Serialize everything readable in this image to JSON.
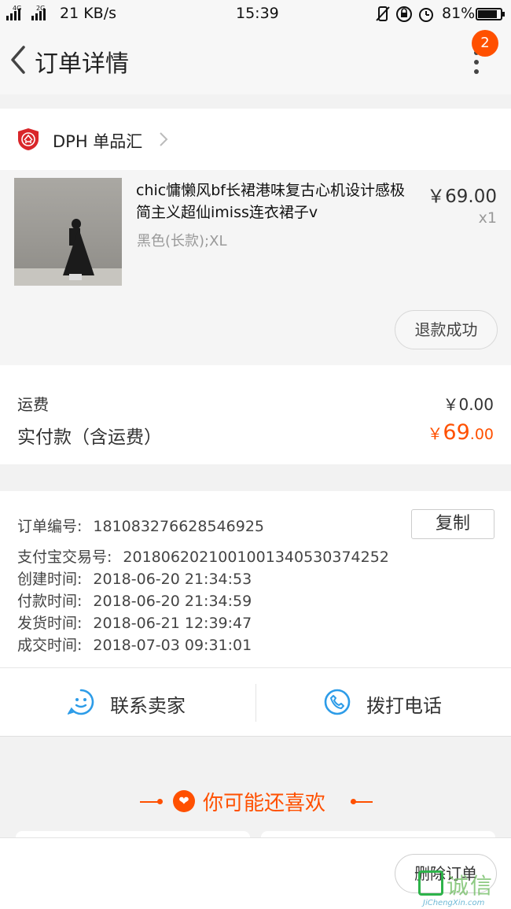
{
  "status_bar": {
    "net_top": "4G",
    "net_bottom": "2G",
    "speed": "21 KB/s",
    "time": "15:39",
    "battery": "81%"
  },
  "header": {
    "title": "订单详情",
    "badge_count": "2"
  },
  "shop": {
    "name": "DPH 单品汇"
  },
  "product": {
    "title": "chic慵懒风bf长裙港味复古心机设计感极简主义超仙imiss连衣裙子v",
    "spec": "黑色(长款);XL",
    "price": "￥69.00",
    "qty": "x1",
    "status_button": "退款成功"
  },
  "totals": {
    "shipping_label": "运费",
    "shipping_value": "￥0.00",
    "paid_label": "实付款（含运费）",
    "paid_currency": "￥",
    "paid_integer": "69",
    "paid_decimal": ".00"
  },
  "order_info": {
    "copy_button": "复制",
    "rows": [
      {
        "label": "订单编号:",
        "value": "181083276628546925"
      },
      {
        "label": "支付宝交易号:",
        "value": "2018062021001001340530374252"
      },
      {
        "label": "创建时间:",
        "value": "2018-06-20 21:34:53"
      },
      {
        "label": "付款时间:",
        "value": "2018-06-20 21:34:59"
      },
      {
        "label": "发货时间:",
        "value": "2018-06-21 12:39:47"
      },
      {
        "label": "成交时间:",
        "value": "2018-07-03 09:31:01"
      }
    ]
  },
  "contact": {
    "seller_label": "联系卖家",
    "phone_label": "拨打电话"
  },
  "recommend": {
    "title": "你可能还喜欢"
  },
  "bottom": {
    "delete_button": "删除订单"
  },
  "watermark": {
    "text": "诚信",
    "sub": "JiChengXin.com"
  },
  "colors": {
    "accent": "#ff5000",
    "link_blue": "#2d9ce8"
  }
}
